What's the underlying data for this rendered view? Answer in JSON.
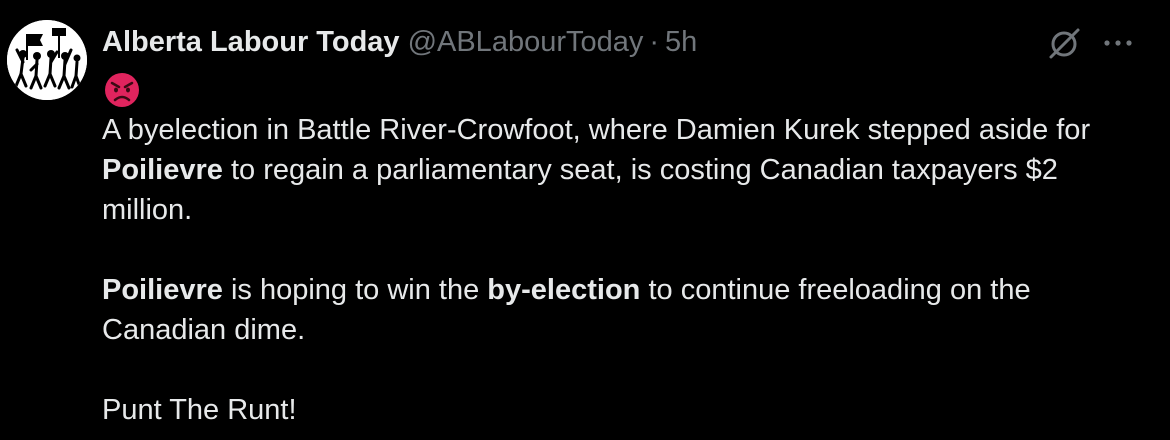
{
  "tweet": {
    "display_name": "Alberta Labour Today",
    "handle": "@ABLabourToday",
    "separator": "·",
    "time": "5h",
    "emoji": "angry-face-emoji",
    "paragraph1": {
      "part1": "A byelection in Battle River-Crowfoot, where Damien Kurek stepped aside for ",
      "bold1": "Poilievre",
      "part2": " to regain a parliamentary seat, is costing Canadian taxpayers $2 million."
    },
    "paragraph2": {
      "bold1": "Poilievre",
      "part1": " is hoping to win the ",
      "bold2": "by-election",
      "part2": " to continue freeloading on the Canadian dime."
    },
    "paragraph3": "Punt The Runt!"
  },
  "colors": {
    "background": "#000000",
    "text": "#e7e9ea",
    "muted": "#71767b",
    "emoji_red": "#e0245e"
  }
}
